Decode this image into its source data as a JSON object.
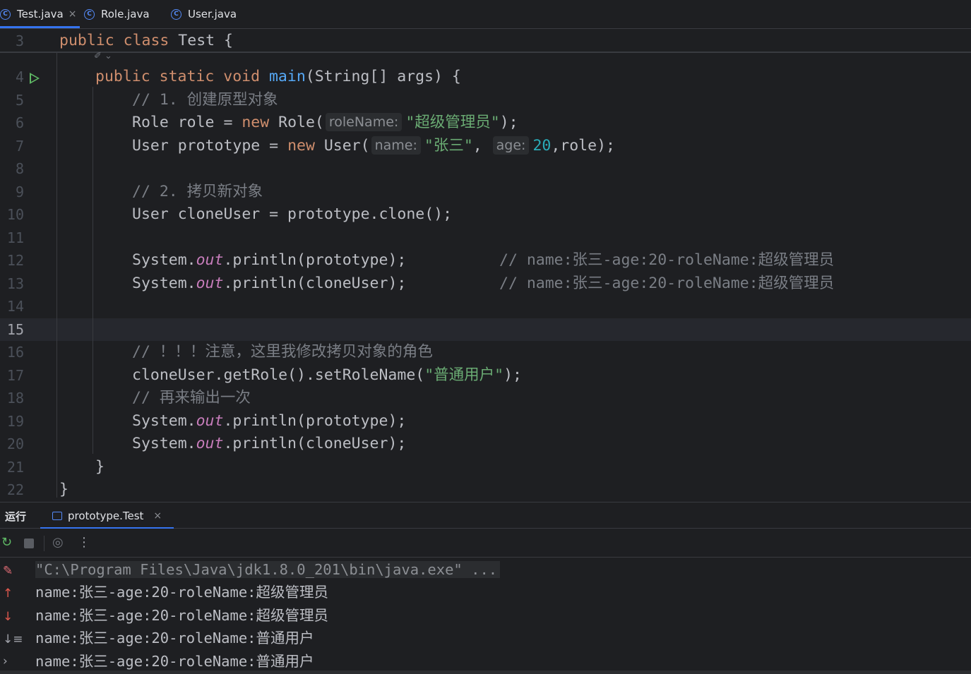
{
  "tabs": [
    {
      "label": "Test.java",
      "close": "×"
    },
    {
      "label": "Role.java"
    },
    {
      "label": "User.java"
    }
  ],
  "class_icon_glyph": "C",
  "sticky_header": {
    "line": "3",
    "public": "public",
    "class": "class",
    "rest": " Test {"
  },
  "ai_hint_glyph": "✐ ⌄",
  "lines": {
    "n4": "4",
    "n5": "5",
    "n6": "6",
    "n7": "7",
    "n8": "8",
    "n9": "9",
    "n10": "10",
    "n11": "11",
    "n12": "12",
    "n13": "13",
    "n14": "14",
    "n15": "15",
    "n16": "16",
    "n17": "17",
    "n18": "18",
    "n19": "19",
    "n20": "20",
    "n21": "21",
    "n22": "22"
  },
  "code": {
    "l4_public": "public",
    "l4_static": "static",
    "l4_void": "void",
    "l4_main": "main",
    "l4_rest": "(String[] args) {",
    "l5": "// 1. 创建原型对象",
    "l6_a": "Role role = ",
    "l6_new": "new",
    "l6_b": " Role(",
    "l6_hint": "roleName:",
    "l6_str": "\"超级管理员\"",
    "l6_c": ");",
    "l7_a": "User prototype = ",
    "l7_new": "new",
    "l7_b": " User(",
    "l7_hint1": "name:",
    "l7_str": "\"张三\"",
    "l7_comma": ", ",
    "l7_hint2": "age:",
    "l7_num": "20",
    "l7_c": ",role);",
    "l9": "// 2. 拷贝新对象",
    "l10": "User cloneUser = prototype.clone();",
    "l12_a": "System.",
    "l12_out": "out",
    "l12_b": ".println(prototype);",
    "l12_cmt": "// name:张三-age:20-roleName:超级管理员",
    "l13_a": "System.",
    "l13_out": "out",
    "l13_b": ".println(cloneUser);",
    "l13_cmt": "// name:张三-age:20-roleName:超级管理员",
    "l16": "// ！！！注意，这里我修改拷贝对象的角色",
    "l17_a": "cloneUser.getRole().setRoleName(",
    "l17_str": "\"普通用户\"",
    "l17_b": ");",
    "l18": "// 再来输出一次",
    "l19_a": "System.",
    "l19_out": "out",
    "l19_b": ".println(prototype);",
    "l20_a": "System.",
    "l20_out": "out",
    "l20_b": ".println(cloneUser);",
    "l21": "}",
    "l22": "}"
  },
  "run_panel": {
    "title": "运行",
    "tab_label": "prototype.Test",
    "tab_close": "×",
    "toolbar": {
      "rerun": "↻",
      "more": "⋮",
      "restore": "◎"
    },
    "side_icons": {
      "softwrap": "✎",
      "up": "↑",
      "down": "↓",
      "sort": "↓≡",
      "expand": "›"
    },
    "output": [
      "\"C:\\Program Files\\Java\\jdk1.8.0_201\\bin\\java.exe\" ...",
      "name:张三-age:20-roleName:超级管理员",
      "name:张三-age:20-roleName:超级管理员",
      "name:张三-age:20-roleName:普通用户",
      "name:张三-age:20-roleName:普通用户"
    ]
  }
}
